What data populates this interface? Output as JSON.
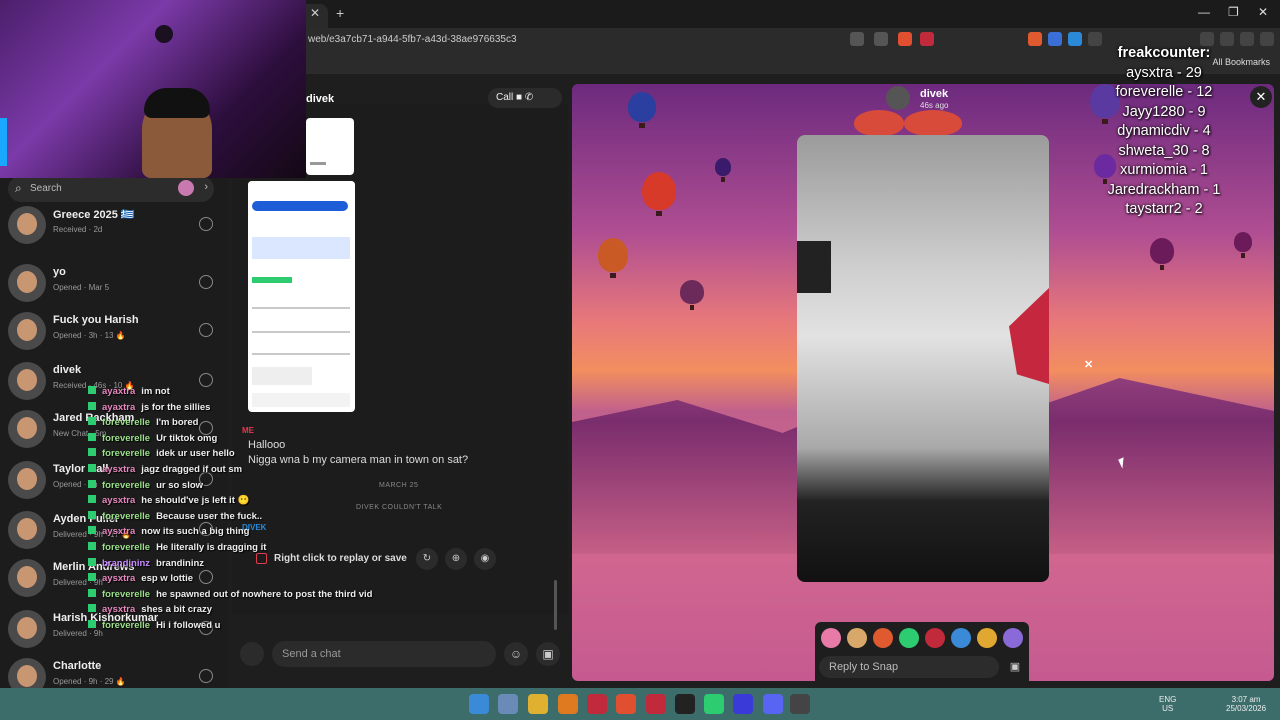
{
  "browser": {
    "url": "web/e3a7cb71-a944-5fb7-a43d-38ae976635c3",
    "bookmarks_label": "All Bookmarks",
    "tab_close": "✕",
    "new_tab": "+",
    "min": "—",
    "restore": "❐",
    "close": "✕"
  },
  "search": {
    "placeholder": "Search"
  },
  "conversations": [
    {
      "name": "Greece 2025 🇬🇷",
      "sub": "Received · 2d"
    },
    {
      "name": "yo",
      "sub": "Opened · Mar 5"
    },
    {
      "name": "Fuck you Harish",
      "sub": "Opened · 3h · 13 🔥"
    },
    {
      "name": "divek",
      "sub": "Received · 46s · 10 🔥"
    },
    {
      "name": "Jared Rackham",
      "sub": "New Chat · 5m"
    },
    {
      "name": "Taylor Hall",
      "sub": "Opened · 9h"
    },
    {
      "name": "Ayden Fuller",
      "sub": "Delivered · 9h · 17 🔥"
    },
    {
      "name": "Merlin Andrews",
      "sub": "Delivered · 9h"
    },
    {
      "name": "Harish Kishorkumar",
      "sub": "Delivered · 9h"
    },
    {
      "name": "Charlotte",
      "sub": "Opened · 9h · 29 🔥"
    }
  ],
  "chat": {
    "name": "divek",
    "call_label": "Call",
    "me_label": "ME",
    "msg1": "Hallooo",
    "msg2": "Nigga wna b my camera man in town on sat?",
    "date": "MARCH 25",
    "note": "DIVEK COULDN'T TALK",
    "divek_label": "DIVEK",
    "replay_text": "Right click to replay or save",
    "compose_placeholder": "Send a chat",
    "reply_label": "Reply"
  },
  "overlay_chat": [
    {
      "user": "ayaxtra",
      "msg": "im not"
    },
    {
      "user": "ayaxtra",
      "msg": "js for the sillies"
    },
    {
      "user": "foreverelle",
      "msg": "I'm bored"
    },
    {
      "user": "foreverelle",
      "msg": "Ur tiktok omg"
    },
    {
      "user": "foreverelle",
      "msg": "idek ur user hello"
    },
    {
      "user": "aysxtra",
      "msg": "jagz dragged if out sm"
    },
    {
      "user": "foreverelle",
      "msg": "ur so slow"
    },
    {
      "user": "aysxtra",
      "msg": "he should've js left it 😶"
    },
    {
      "user": "foreverelle",
      "msg": "Because user the fuck.."
    },
    {
      "user": "aysxtra",
      "msg": "now its such a big thing"
    },
    {
      "user": "foreverelle",
      "msg": "He literally is dragging it"
    },
    {
      "user": "brandininz",
      "msg": "brandininz"
    },
    {
      "user": "aysxtra",
      "msg": "esp w lottie"
    },
    {
      "user": "foreverelle",
      "msg": "he spawned out of nowhere to post the third vid"
    },
    {
      "user": "aysxtra",
      "msg": "shes a bit crazy"
    },
    {
      "user": "foreverelle",
      "msg": "Hi i followed u"
    }
  ],
  "snap": {
    "user": "divek",
    "time": "46s ago",
    "reply_placeholder": "Reply to Snap",
    "close": "✕",
    "mini_close": "✕"
  },
  "counter": {
    "title": "freakcounter:",
    "lines": [
      "aysxtra - 29",
      "foreverelle - 12",
      "Jayy1280 - 9",
      "dynamicdiv - 4",
      "shweta_30 - 8",
      "xurmiomia - 1",
      "Jaredrackham - 1",
      "taystarr2 - 2"
    ]
  },
  "taskbar": {
    "lang1": "ENG",
    "lang2": "US",
    "time": "3:07 am",
    "date": "25/03/2026"
  },
  "colors": {
    "accent_blue": "#1d5dd8",
    "snap_red": "#e03a4f",
    "taskbar": "#3c6d6b",
    "badge_green": "#2ecc71"
  }
}
